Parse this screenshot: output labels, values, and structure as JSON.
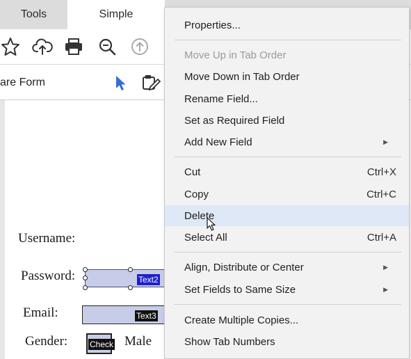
{
  "tabs": [
    {
      "label": "Tools"
    },
    {
      "label": "Simple"
    }
  ],
  "toolbar": {
    "icons": [
      "star-icon",
      "cloud-upload-icon",
      "print-icon",
      "zoom-icon",
      "up-arrow-icon"
    ]
  },
  "form_toolbar": {
    "label": "are Form"
  },
  "form": {
    "username_label": "Username:",
    "password_label": "Password:",
    "password_field_name": "Text2",
    "email_label": "Email:",
    "email_field_name": "Text3",
    "gender_label": "Gender:",
    "checkbox_field_name": "Check",
    "male_label": "Male"
  },
  "context_menu": {
    "properties": "Properties...",
    "move_up": "Move Up in Tab Order",
    "move_down": "Move Down in Tab Order",
    "rename_field": "Rename Field...",
    "set_required": "Set as Required Field",
    "add_new_field": "Add New Field",
    "cut": "Cut",
    "cut_shortcut": "Ctrl+X",
    "copy": "Copy",
    "copy_shortcut": "Ctrl+C",
    "delete": "Delete",
    "select_all": "Select All",
    "select_all_shortcut": "Ctrl+A",
    "align_distribute": "Align, Distribute or Center",
    "set_same_size": "Set Fields to Same Size",
    "create_copies": "Create Multiple Copies...",
    "show_tab_numbers": "Show Tab Numbers"
  },
  "colors": {
    "field_fill": "#c7cde8",
    "selected_tag": "#1f1fcc",
    "menu_hover": "#dfe8f6",
    "pointer_blue": "#2f6fd6"
  }
}
